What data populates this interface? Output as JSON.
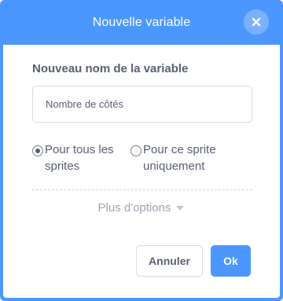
{
  "dialog": {
    "title": "Nouvelle variable",
    "close_icon": "close-icon"
  },
  "form": {
    "label": "Nouveau nom de la variable",
    "input_value": "",
    "input_placeholder": "Nombre de côtés"
  },
  "scope": {
    "options": [
      {
        "label": "Pour tous les sprites",
        "selected": true
      },
      {
        "label": "Pour ce sprite uniquement",
        "selected": false
      }
    ]
  },
  "more_options": {
    "label": "Plus d'options",
    "icon": "caret-down-icon"
  },
  "buttons": {
    "cancel_label": "Annuler",
    "ok_label": "Ok"
  },
  "colors": {
    "accent": "#4c97ff",
    "text": "#575e75",
    "muted": "#9ea3b1"
  }
}
